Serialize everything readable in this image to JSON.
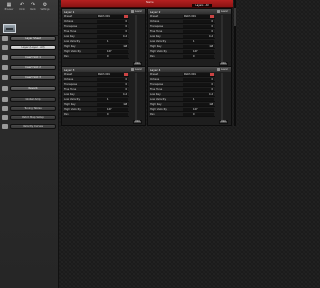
{
  "toolbar": {
    "items": [
      {
        "icon": "grid-icon",
        "label": "Browser"
      },
      {
        "icon": "undo-icon",
        "label": "Undo"
      },
      {
        "icon": "redo-icon",
        "label": "Redo"
      },
      {
        "icon": "settings-icon",
        "label": "Settings"
      }
    ]
  },
  "sidebar": {
    "items": [
      {
        "label": "Layer Sheet",
        "icon": "layer-icon",
        "selected": false
      },
      {
        "label": "Layer (Layer · All)",
        "icon": "layers-icon",
        "selected": true
      },
      {
        "label": "Insert Slot 1",
        "icon": "insert-icon",
        "selected": false
      },
      {
        "label": "Insert Slot 2",
        "icon": "insert-icon",
        "selected": false
      },
      {
        "label": "Insert Slot 3",
        "icon": "insert-icon",
        "selected": false
      },
      {
        "label": "Reverb",
        "icon": "reverb-icon",
        "selected": false
      },
      {
        "label": "Global Amp",
        "icon": "amp-icon",
        "selected": false
      },
      {
        "label": "Tuning Tables",
        "icon": "tuning-icon",
        "selected": false
      },
      {
        "label": "Patch Map Setup",
        "icon": "map-icon",
        "selected": false
      },
      {
        "label": "Velocity Curves",
        "icon": "curve-icon",
        "selected": false
      }
    ]
  },
  "header": {
    "name_label": "Name",
    "name_value": "Layers · All"
  },
  "layers": [
    {
      "title": "Layer 1",
      "level_label": "Level",
      "button_label": "Edit",
      "rows": [
        {
          "label": "Preset",
          "value": "Patch  001"
        },
        {
          "label": "Octave",
          "value": "0"
        },
        {
          "label": "Transpose",
          "value": "0"
        },
        {
          "label": "Fine Tune",
          "value": "0"
        },
        {
          "label": "Low Key",
          "value": "C-2"
        },
        {
          "label": "Low Velocity",
          "value": "1"
        },
        {
          "label": "High Key",
          "value": "G8"
        },
        {
          "label": "High Velocity",
          "value": "127"
        },
        {
          "label": "Pan",
          "value": "0"
        }
      ]
    },
    {
      "title": "Layer 2",
      "level_label": "Level",
      "button_label": "Edit",
      "rows": [
        {
          "label": "Preset",
          "value": "Patch  001"
        },
        {
          "label": "Octave",
          "value": "0"
        },
        {
          "label": "Transpose",
          "value": "0"
        },
        {
          "label": "Fine Tune",
          "value": "0"
        },
        {
          "label": "Low Key",
          "value": "C-2"
        },
        {
          "label": "Low Velocity",
          "value": "1"
        },
        {
          "label": "High Key",
          "value": "G8"
        },
        {
          "label": "High Velocity",
          "value": "127"
        },
        {
          "label": "Pan",
          "value": "0"
        }
      ]
    },
    {
      "title": "Layer 3",
      "level_label": "Level",
      "button_label": "Edit",
      "rows": [
        {
          "label": "Preset",
          "value": "Patch  001"
        },
        {
          "label": "Octave",
          "value": "0"
        },
        {
          "label": "Transpose",
          "value": "0"
        },
        {
          "label": "Fine Tune",
          "value": "0"
        },
        {
          "label": "Low Key",
          "value": "C-2"
        },
        {
          "label": "Low Velocity",
          "value": "1"
        },
        {
          "label": "High Key",
          "value": "G8"
        },
        {
          "label": "High Velocity",
          "value": "127"
        },
        {
          "label": "Pan",
          "value": "0"
        }
      ]
    },
    {
      "title": "Layer 4",
      "level_label": "Level",
      "button_label": "Edit",
      "rows": [
        {
          "label": "Preset",
          "value": "Patch  001"
        },
        {
          "label": "Octave",
          "value": "0"
        },
        {
          "label": "Transpose",
          "value": "0"
        },
        {
          "label": "Fine Tune",
          "value": "0"
        },
        {
          "label": "Low Key",
          "value": "C-2"
        },
        {
          "label": "Low Velocity",
          "value": "1"
        },
        {
          "label": "High Key",
          "value": "G8"
        },
        {
          "label": "High Velocity",
          "value": "127"
        },
        {
          "label": "Pan",
          "value": "0"
        }
      ]
    }
  ],
  "colors": {
    "accent": "#b62020",
    "panel": "#1e1e1e",
    "sidebar": "#2c2c2c",
    "selected": "#d6d6d6"
  }
}
